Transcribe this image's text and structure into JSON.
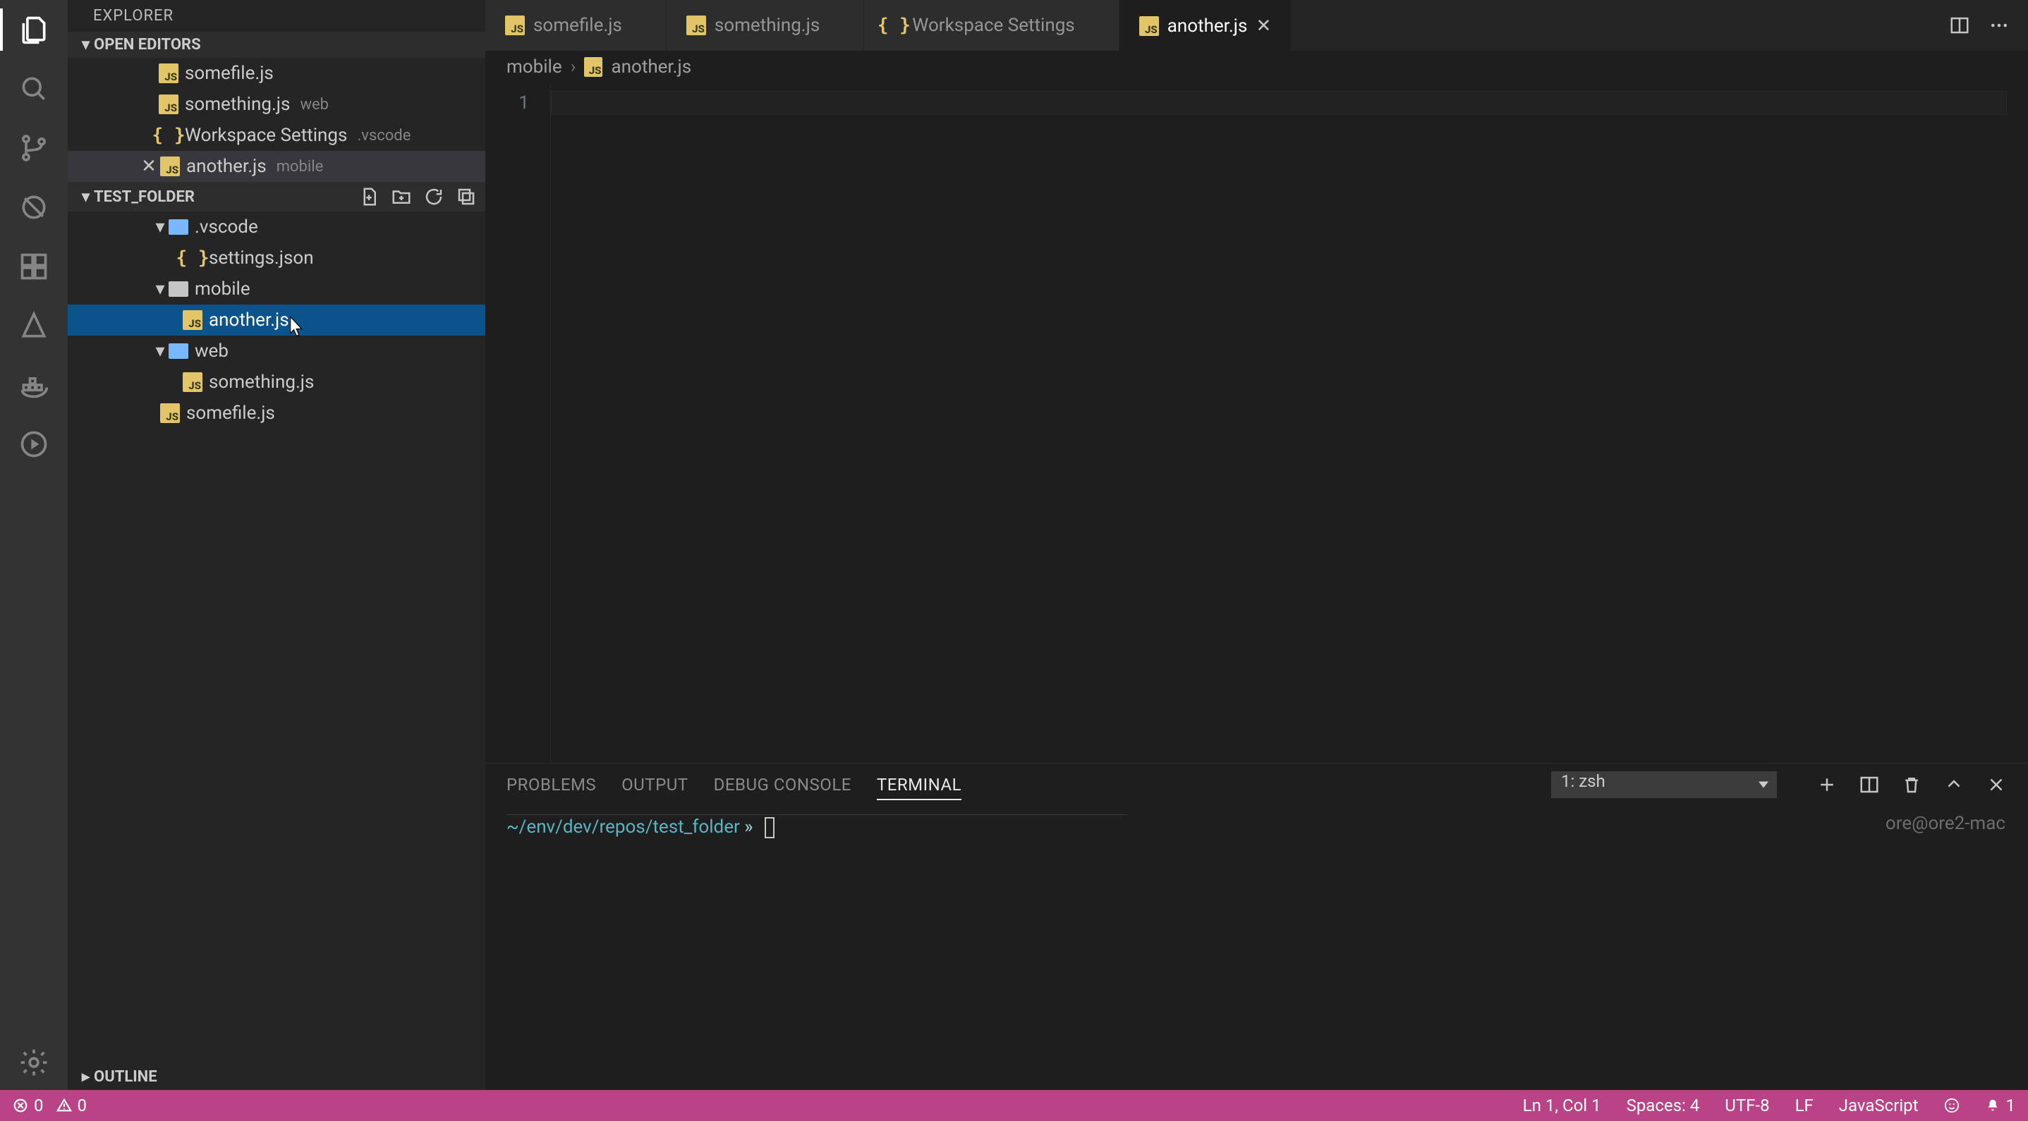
{
  "sidebar": {
    "title": "EXPLORER",
    "open_editors_label": "OPEN EDITORS",
    "project_label": "TEST_FOLDER",
    "outline_label": "OUTLINE",
    "open_editors": [
      {
        "name": "somefile.js",
        "hint": "",
        "icon": "js",
        "active": false
      },
      {
        "name": "something.js",
        "hint": "web",
        "icon": "js",
        "active": false
      },
      {
        "name": "Workspace Settings",
        "hint": ".vscode",
        "icon": "json",
        "active": false
      },
      {
        "name": "another.js",
        "hint": "mobile",
        "icon": "js",
        "active": true
      }
    ],
    "tree": {
      "vscode_folder": ".vscode",
      "settings_file": "settings.json",
      "mobile_folder": "mobile",
      "another_file": "another.js",
      "web_folder": "web",
      "something_file": "something.js",
      "somefile_file": "somefile.js"
    }
  },
  "tabs": [
    {
      "name": "somefile.js",
      "icon": "js",
      "active": false
    },
    {
      "name": "something.js",
      "icon": "js",
      "active": false
    },
    {
      "name": "Workspace Settings",
      "icon": "json",
      "active": false
    },
    {
      "name": "another.js",
      "icon": "js",
      "active": true
    }
  ],
  "breadcrumb": {
    "part1": "mobile",
    "part2": "another.js"
  },
  "editor": {
    "line_numbers": [
      "1"
    ]
  },
  "panel": {
    "tabs": {
      "problems": "PROBLEMS",
      "output": "OUTPUT",
      "debug_console": "DEBUG CONSOLE",
      "terminal": "TERMINAL"
    },
    "terminal_selector": "1: zsh",
    "prompt_path": "~/env/dev/repos/test_folder",
    "prompt_sep": " » ",
    "host": "ore@ore2-mac"
  },
  "status": {
    "errors": "0",
    "warnings": "0",
    "line_col": "Ln 1, Col 1",
    "spaces": "Spaces: 4",
    "encoding": "UTF-8",
    "eol": "LF",
    "language": "JavaScript",
    "notifications": "1"
  }
}
